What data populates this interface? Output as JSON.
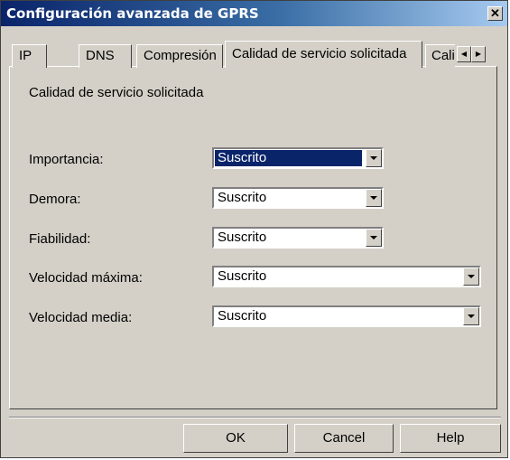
{
  "window": {
    "title": "Configuración avanzada de GPRS",
    "close_glyph": "✕"
  },
  "tabs": [
    {
      "label": "IP"
    },
    {
      "label": "DNS"
    },
    {
      "label": "Compresión"
    },
    {
      "label": "Calidad de servicio solicitada",
      "active": true
    },
    {
      "label": "Calid"
    }
  ],
  "tab_scroll": {
    "left_glyph": "◀",
    "right_glyph": "▶"
  },
  "panel": {
    "heading": "Calidad de servicio solicitada",
    "fields": [
      {
        "label": "Importancia:",
        "value": "Suscrito",
        "selected": true
      },
      {
        "label": "Demora:",
        "value": "Suscrito"
      },
      {
        "label": "Fiabilidad:",
        "value": "Suscrito"
      },
      {
        "label": "Velocidad máxima:",
        "value": "Suscrito"
      },
      {
        "label": "Velocidad media:",
        "value": "Suscrito"
      }
    ]
  },
  "buttons": {
    "ok": "OK",
    "cancel": "Cancel",
    "help": "Help"
  }
}
